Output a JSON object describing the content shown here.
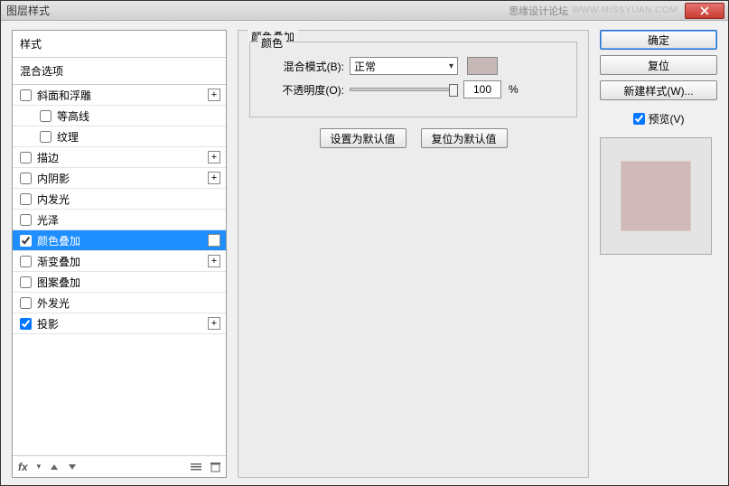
{
  "window": {
    "title": "图层样式",
    "brand": "思缘设计论坛",
    "url": "WWW.MISSYUAN.COM"
  },
  "styles": {
    "header": "样式",
    "subheader": "混合选项",
    "items": [
      {
        "label": "斜面和浮雕",
        "checked": false,
        "plus": true
      },
      {
        "label": "等高线",
        "checked": false,
        "sub": true
      },
      {
        "label": "纹理",
        "checked": false,
        "sub": true
      },
      {
        "label": "描边",
        "checked": false,
        "plus": true
      },
      {
        "label": "内阴影",
        "checked": false,
        "plus": true
      },
      {
        "label": "内发光",
        "checked": false
      },
      {
        "label": "光泽",
        "checked": false
      },
      {
        "label": "颜色叠加",
        "checked": true,
        "selected": true,
        "plus": true
      },
      {
        "label": "渐变叠加",
        "checked": false,
        "plus": true
      },
      {
        "label": "图案叠加",
        "checked": false
      },
      {
        "label": "外发光",
        "checked": false
      },
      {
        "label": "投影",
        "checked": true,
        "plus": true
      }
    ],
    "footer_fx": "fx"
  },
  "settings": {
    "group_title": "颜色叠加",
    "color_legend": "颜色",
    "blend_label": "混合模式(B):",
    "blend_value": "正常",
    "opacity_label": "不透明度(O):",
    "opacity_value": "100",
    "opacity_unit": "%",
    "swatch_color": "#c7b8b8",
    "set_default": "设置为默认值",
    "reset_default": "复位为默认值"
  },
  "actions": {
    "ok": "确定",
    "cancel": "复位",
    "new_style": "新建样式(W)...",
    "preview": "预览(V)",
    "preview_checked": true
  }
}
